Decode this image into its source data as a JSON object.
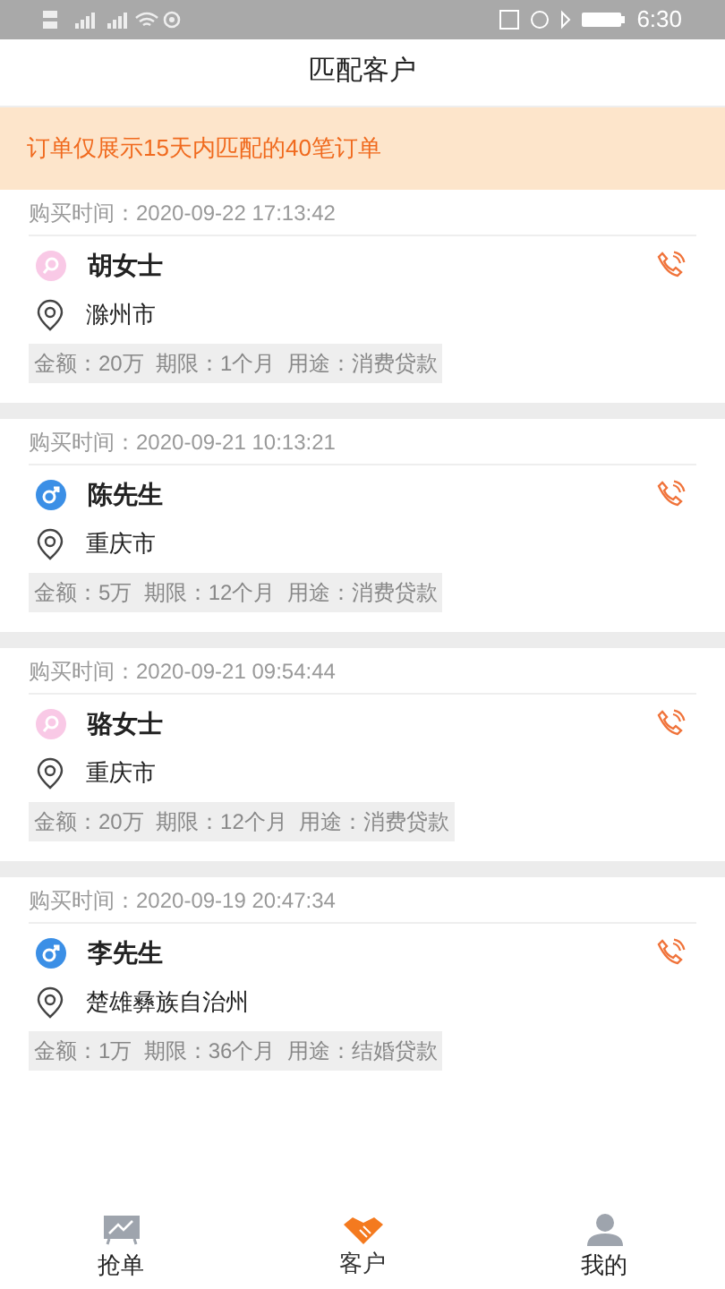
{
  "status_bar": {
    "time": "6:30"
  },
  "header": {
    "title": "匹配客户"
  },
  "notice": "订单仅展示15天内匹配的40笔订单",
  "orders": [
    {
      "time": "购买时间：2020-09-22 17:13:42",
      "kind": "female",
      "name": "胡女士",
      "city": "滁州市",
      "details": "金额：20万  期限：1个月  用途：消费贷款"
    },
    {
      "time": "购买时间：2020-09-21 10:13:21",
      "kind": "male",
      "name": "陈先生",
      "city": "重庆市",
      "details": "金额：5万  期限：12个月  用途：消费贷款"
    },
    {
      "time": "购买时间：2020-09-21 09:54:44",
      "kind": "female",
      "name": "骆女士",
      "city": "重庆市",
      "details": "金额：20万  期限：12个月  用途：消费贷款"
    },
    {
      "time": "购买时间：2020-09-19 20:47:34",
      "kind": "male",
      "name": "李先生",
      "city": "楚雄彝族自治州",
      "details": "金额：1万  期限：36个月  用途：结婚贷款"
    }
  ],
  "tabs": [
    {
      "label": "抢单",
      "kind": "chart",
      "selected": false
    },
    {
      "label": "客户",
      "kind": "handshake",
      "selected": true
    },
    {
      "label": "我的",
      "kind": "person",
      "selected": false
    }
  ]
}
